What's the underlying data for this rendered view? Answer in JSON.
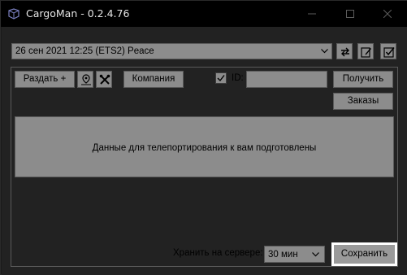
{
  "window": {
    "title": "CargoMan - 0.2.4.76",
    "controls": [
      "minimize-icon",
      "maximize-icon",
      "close-icon"
    ]
  },
  "profile": {
    "selected": "26 сен 2021 12:25  (ETS2)  Peace"
  },
  "toolbar": {
    "teleport_label": "Раздать +",
    "company_label": "Компания",
    "id_label": "ID:",
    "id_value": "",
    "id_checked": true,
    "get_label": "Получить",
    "orders_label": "Заказы"
  },
  "message": "Данные для телепортирования к вам подготовлены",
  "footer": {
    "store_label": "Хранить на сервере:",
    "store_value": "30 мин",
    "save_label": "Сохранить"
  },
  "colors": {
    "titlebar": "#000000",
    "control_bg": "#8c8c8c",
    "overlay": "#222222",
    "focus_border": "#ffffff"
  }
}
